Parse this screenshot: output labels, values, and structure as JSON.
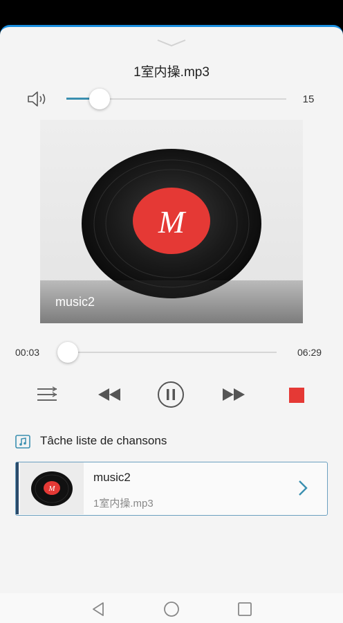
{
  "player": {
    "title": "1室内操.mp3",
    "volume": {
      "value": 15,
      "label": "15",
      "fraction": 0.15
    },
    "cover": {
      "label": "music2",
      "disc_letter": "M"
    },
    "progress": {
      "current": "00:03",
      "total": "06:29",
      "fraction": 0.008
    }
  },
  "playlist": {
    "title": "Tâche liste de chansons",
    "items": [
      {
        "name": "music2",
        "file": "1室内操.mp3",
        "disc_letter": "M"
      }
    ]
  },
  "colors": {
    "accent": "#3a8fb0",
    "stop": "#e53935",
    "disc_label": "#e53935"
  },
  "icons": {
    "volume": "speaker-icon",
    "playlist_mode": "list-icon",
    "previous": "rewind-icon",
    "pause": "pause-icon",
    "next": "fast-forward-icon",
    "stop": "stop-icon",
    "playlist": "music-note-icon",
    "open": "chevron-right-icon",
    "nav_back": "triangle-back-icon",
    "nav_home": "circle-home-icon",
    "nav_recent": "square-recent-icon"
  }
}
